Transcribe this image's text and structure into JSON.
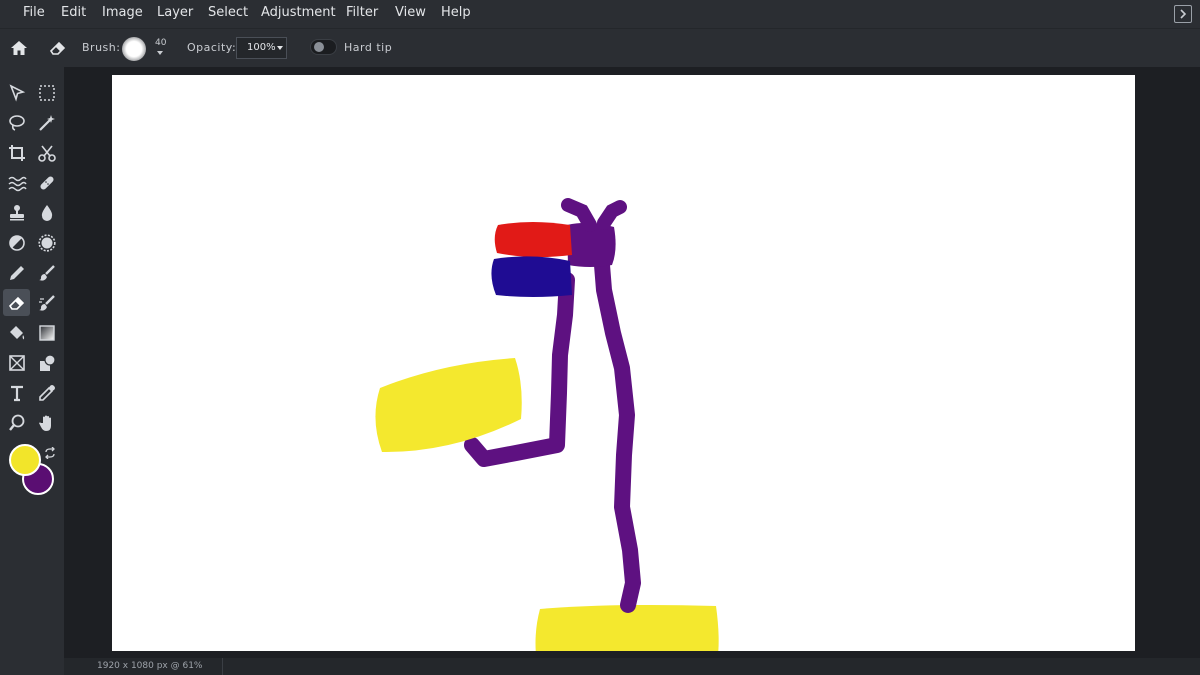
{
  "menu": {
    "items": [
      "File",
      "Edit",
      "Image",
      "Layer",
      "Select",
      "Adjustment",
      "Filter",
      "View",
      "Help"
    ]
  },
  "options": {
    "brush_label": "Brush:",
    "brush_size": "40",
    "opacity_label": "Opacity:",
    "opacity_value": "100%",
    "hard_tip_label": "Hard tip",
    "hard_tip_on": false
  },
  "toolbar": {
    "active_tool": "eraser-tool",
    "tools": [
      "move-tool-icon",
      "marquee-select-icon",
      "lasso-icon",
      "magic-wand-icon",
      "crop-icon",
      "scissors-icon",
      "liquify-icon",
      "healing-bandage-icon",
      "clone-stamp-icon",
      "blur-drop-icon",
      "dodge-burn-icon",
      "sponge-icon",
      "pencil-icon",
      "brush-icon",
      "eraser-icon",
      "smudge-brush-icon",
      "paint-bucket-icon",
      "gradient-icon",
      "frame-icon",
      "shape-icon",
      "text-icon",
      "eyedropper-icon",
      "zoom-icon",
      "hand-icon"
    ],
    "foreground_color": "#f2e52a",
    "background_color": "#5a0e72"
  },
  "canvas": {
    "colors": {
      "purple": "#5e1181",
      "red": "#e11a17",
      "blue": "#1f0c93",
      "yellow": "#f4e82e"
    }
  },
  "status": {
    "text": "1920 x 1080 px @ 61%"
  }
}
